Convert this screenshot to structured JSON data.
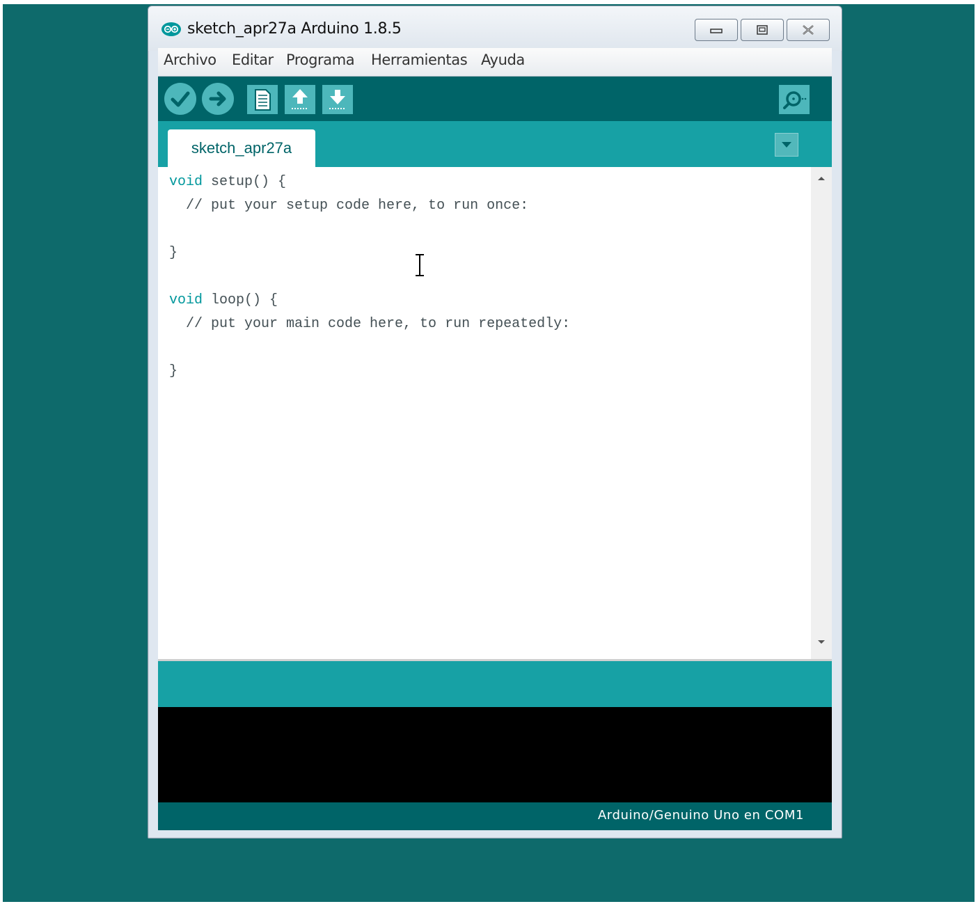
{
  "window": {
    "title": "sketch_apr27a Arduino 1.8.5"
  },
  "menu": {
    "items": [
      "Archivo",
      "Editar",
      "Programa",
      "Herramientas",
      "Ayuda"
    ]
  },
  "toolbar": {
    "buttons": [
      "verify-icon",
      "upload-icon",
      "new-icon",
      "open-icon",
      "save-icon"
    ],
    "serial_monitor": "serial-monitor-icon"
  },
  "tabs": {
    "active": "sketch_apr27a"
  },
  "editor": {
    "lines": [
      {
        "kw": "void",
        "rest": " setup() {"
      },
      {
        "kw": "",
        "rest": "  // put your setup code here, to run once:"
      },
      {
        "kw": "",
        "rest": ""
      },
      {
        "kw": "",
        "rest": "}"
      },
      {
        "kw": "",
        "rest": ""
      },
      {
        "kw": "void",
        "rest": " loop() {"
      },
      {
        "kw": "",
        "rest": "  // put your main code here, to run repeatedly:"
      },
      {
        "kw": "",
        "rest": ""
      },
      {
        "kw": "",
        "rest": "}"
      }
    ]
  },
  "footer": {
    "board": "Arduino/Genuino Uno en COM1"
  },
  "colors": {
    "desktop": "#0e6a6b",
    "toolbar": "#006468",
    "tabbar": "#17a1a5",
    "keyword": "#00979c"
  }
}
